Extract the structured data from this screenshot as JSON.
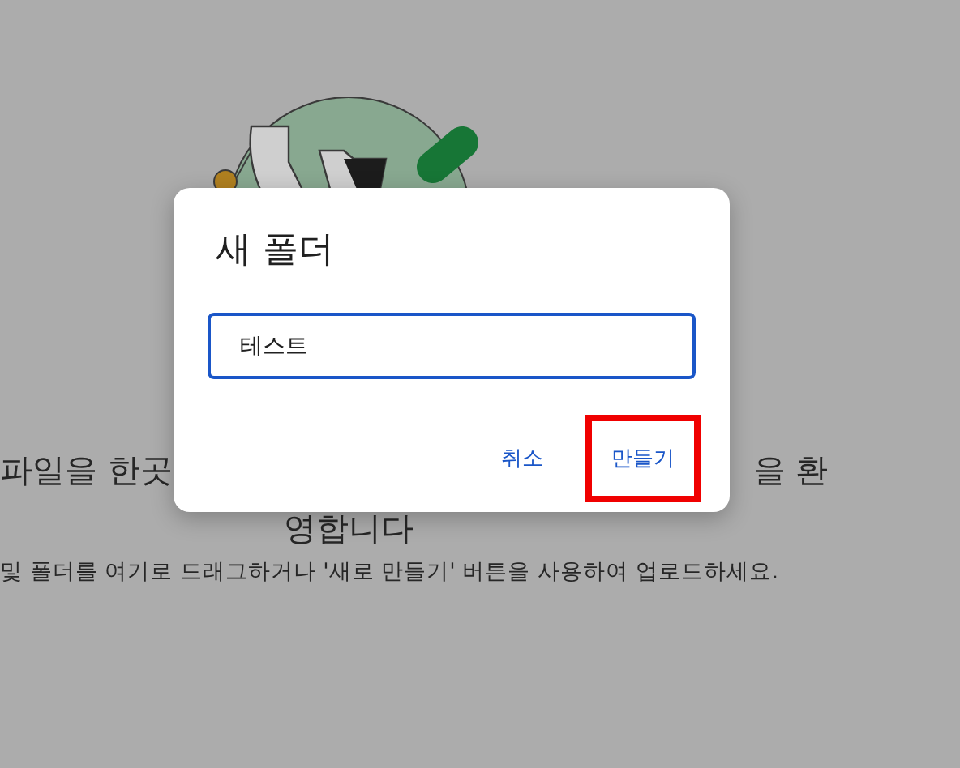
{
  "background": {
    "heading_left": "파일을 한곳",
    "heading_right": "을 환",
    "heading_line2": "영합니다",
    "subtitle": "및 폴더를 여기로 드래그하거나 '새로 만들기' 버튼을 사용하여 업로드하세요."
  },
  "dialog": {
    "title": "새 폴더",
    "input": {
      "value": "테스트",
      "focused": true
    },
    "buttons": [
      {
        "label": "취소",
        "highlighted": false
      },
      {
        "label": "만들기",
        "highlighted": true
      }
    ]
  }
}
